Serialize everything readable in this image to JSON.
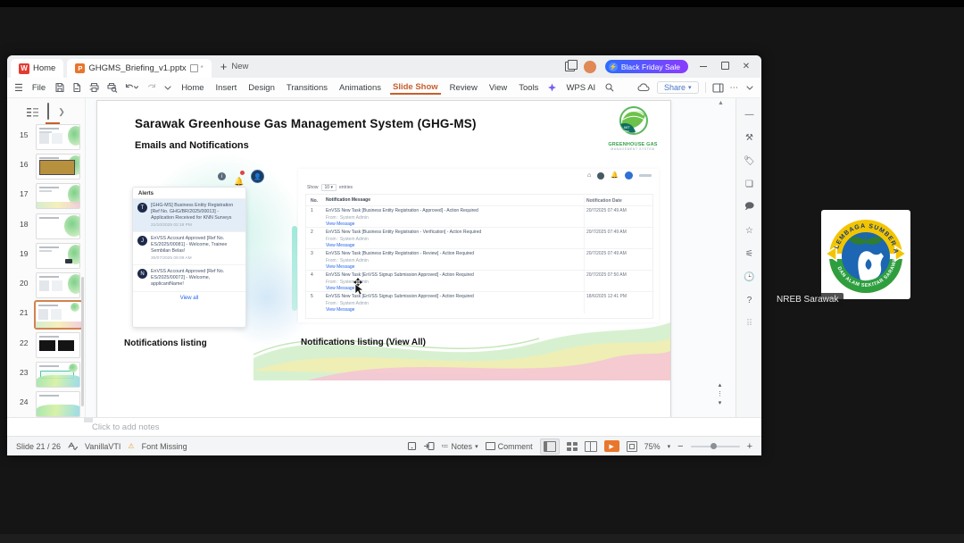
{
  "meeting": {
    "participant_label": "NREB Sarawak",
    "logo": {
      "top_text": "LEMBAGA SUMBER ASLI",
      "bottom_text": "DAN ALAM SEKITAR SARAWAK"
    }
  },
  "window": {
    "tabs": {
      "home": "Home",
      "document": "GHGMS_Briefing_v1.pptx",
      "modified": "*",
      "new": "New",
      "sale": "Black Friday Sale"
    },
    "menubar": {
      "file": "File",
      "items": [
        "Home",
        "Insert",
        "Design",
        "Transitions",
        "Animations",
        "Slide Show",
        "Review",
        "View",
        "Tools",
        "WPS AI"
      ],
      "share": "Share"
    }
  },
  "thumbnails": {
    "add": "+",
    "items": [
      {
        "num": "15"
      },
      {
        "num": "16"
      },
      {
        "num": "17"
      },
      {
        "num": "18"
      },
      {
        "num": "19"
      },
      {
        "num": "20"
      },
      {
        "num": "21"
      },
      {
        "num": "22"
      },
      {
        "num": "23"
      },
      {
        "num": "24"
      }
    ]
  },
  "slide": {
    "title": "Sarawak Greenhouse Gas Management System (GHG-MS)",
    "subtitle": "Emails and Notifications",
    "logo": {
      "badge": "NET ZERO 2050",
      "line1": "GREENHOUSE GAS",
      "line2": "MANAGEMENT SYSTEM"
    },
    "captions": {
      "left": "Notifications listing",
      "right": "Notifications listing (View All)"
    },
    "alerts": {
      "header": "Alerts",
      "view_all": "View all",
      "items": [
        {
          "avatar": "T",
          "text": "[GHG-MS] Business Entity Registration [Ref No. GHG/BR/2025/00013] - Application Received for KNN Surveys",
          "time": "21/10/2025 02:19 PM"
        },
        {
          "avatar": "J",
          "text": "EnVSS Account Approved [Ref No. ES/2025/00081] - Welcome, Trainee Sembilan Belas!",
          "time": "30/07/2025 09:09 AM"
        },
        {
          "avatar": "N",
          "text": "EnVSS Account Approved [Ref No. ES/2025/00072] - Welcome, applicantName!",
          "time": ""
        }
      ]
    },
    "portal": {
      "show": "Show",
      "page_size": "10",
      "entries": "entries",
      "headers": {
        "no": "No.",
        "message": "Notification Message",
        "date": "Notification Date"
      },
      "rows": [
        {
          "no": "1",
          "message": "EnVSS New Task [Business Entity Registration - Approved] - Action Required",
          "from": "From : System Admin",
          "link": "View Message",
          "date": "20/7/2025 07:49 AM"
        },
        {
          "no": "2",
          "message": "EnVSS New Task [Business Entity Registration - Verification] - Action Required",
          "from": "From : System Admin",
          "link": "View Message",
          "date": "20/7/2025 07:49 AM"
        },
        {
          "no": "3",
          "message": "EnVSS New Task [Business Entity Registration - Review] - Action Required",
          "from": "From : System Admin",
          "link": "View Message",
          "date": "20/7/2025 07:49 AM"
        },
        {
          "no": "4",
          "message": "EnVSS New Task [EnVSS Signup Submission Approved] - Action Required",
          "from": "From : System Admin",
          "link": "View Message",
          "date": "20/7/2025 07:50 AM"
        },
        {
          "no": "5",
          "message": "EnVSS New Task [EnVSS Signup Submission Approved] - Action Required",
          "from": "From : System Admin",
          "link": "View Message",
          "date": "18/6/2025 12:41 PM"
        }
      ]
    }
  },
  "notes": {
    "placeholder": "Click to add notes"
  },
  "statusbar": {
    "slide_indicator": "Slide 21 / 26",
    "theme": "VanillaVTI",
    "warning": "Font Missing",
    "notes": "Notes",
    "comment": "Comment",
    "zoom": "75%"
  }
}
